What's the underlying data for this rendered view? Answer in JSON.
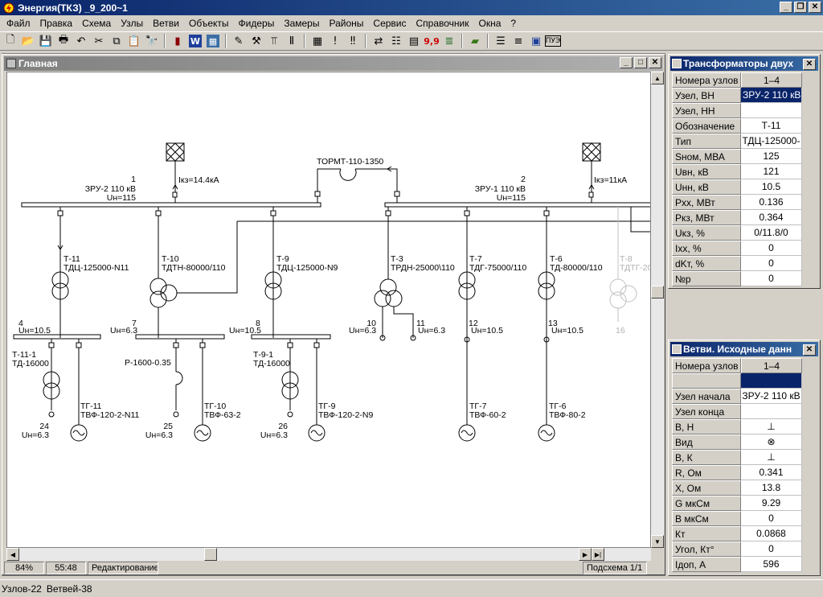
{
  "window": {
    "title": "Энергия(ТКЗ) _9_200~1",
    "minimize": "_",
    "restore": "❐",
    "close": "✕"
  },
  "menu": [
    "Файл",
    "Правка",
    "Схема",
    "Узлы",
    "Ветви",
    "Объекты",
    "Фидеры",
    "Замеры",
    "Районы",
    "Сервис",
    "Справочник",
    "Окна",
    "?"
  ],
  "toolbar": {
    "icons": [
      "new-file-icon",
      "open-folder-icon",
      "save-icon",
      "print-icon",
      "undo-icon",
      "cut-icon",
      "copy-icon",
      "paste-icon",
      "find-icon",
      "sep",
      "book-icon",
      "word-icon",
      "excel-icon",
      "sep",
      "pen-icon",
      "tool-icon",
      "insulator-icon",
      "pillar-icon",
      "sep",
      "table-icon",
      "exclaim-icon",
      "double-exclaim-icon",
      "sep",
      "swap-icon",
      "grid-icon",
      "calc-icon",
      "digits-icon",
      "bars-icon",
      "sep",
      "book-green-icon",
      "sep",
      "lines-icon",
      "doc-lines-icon",
      "window-icon",
      "pu3-icon"
    ],
    "digits_label": "9,9",
    "pu3_label": "ПУЭ"
  },
  "main": {
    "title": "Главная",
    "status": {
      "zoom": "84%",
      "coords": "55:48",
      "mode": "Редактирование",
      "subscheme": "Подсхема 1/1"
    }
  },
  "diagram": {
    "labels": {
      "node1": [
        "1",
        "ЗРУ-2 110 кВ",
        "Uн=115"
      ],
      "node2": [
        "2",
        "ЗРУ-1 110 кВ",
        "Uн=115"
      ],
      "ikz1": "Iкз=14.4кА",
      "ikz2": "Iкз=11кА",
      "reactor_top": "ТОРМТ-110-1350",
      "t11": [
        "Т-11",
        "ТДЦ-125000-N11"
      ],
      "t10": [
        "Т-10",
        "ТДТН-80000/110"
      ],
      "t9": [
        "Т-9",
        "ТДЦ-125000-N9"
      ],
      "t3": [
        "Т-3",
        "ТРДН-25000\\110"
      ],
      "t7": [
        "Т-7",
        "ТДГ-75000/110"
      ],
      "t6": [
        "Т-6",
        "ТД-80000/110"
      ],
      "t8": [
        "Т-8",
        "ТДТГ-20"
      ],
      "n4": [
        "4",
        "Uн=10.5"
      ],
      "n7": [
        "7",
        "Uн=6.3"
      ],
      "n8": [
        "8",
        "Uн=10.5"
      ],
      "n10": [
        "10",
        "Uн=6.3"
      ],
      "n11": [
        "11",
        "Uн=6.3"
      ],
      "n12": [
        "12",
        "Uн=10.5"
      ],
      "n13": [
        "13",
        "Uн=10.5"
      ],
      "n16": "16",
      "t111": [
        "Т-11-1",
        "ТД-16000"
      ],
      "t91": [
        "Т-9-1",
        "ТД-16000"
      ],
      "reactor_p": "Р-1600-0.35",
      "n24": [
        "24",
        "Uн=6.3"
      ],
      "n25": [
        "25",
        "Uн=6.3"
      ],
      "n26": [
        "26",
        "Uн=6.3"
      ],
      "g11": [
        "ТГ-11",
        "ТВФ-120-2-N11"
      ],
      "g10": [
        "ТГ-10",
        "ТВФ-63-2"
      ],
      "g9": [
        "ТГ-9",
        "ТВФ-120-2-N9"
      ],
      "g7": [
        "ТГ-7",
        "ТВФ-60-2"
      ],
      "g6": [
        "ТГ-6",
        "ТВФ-80-2"
      ]
    }
  },
  "transformers_panel": {
    "title": "Трансформаторы двух",
    "rows": [
      {
        "label": "Номера узлов",
        "value": "1–4"
      },
      {
        "label": "Узел, ВН",
        "value": "ЗРУ-2 110 кВ"
      },
      {
        "label": "Узел, НН",
        "value": ""
      },
      {
        "label": "Обозначение",
        "value": "Т-11"
      },
      {
        "label": "Тип",
        "value": "ТДЦ-125000-"
      },
      {
        "label": "Sном, МВА",
        "value": "125"
      },
      {
        "label": "Uвн, кВ",
        "value": "121"
      },
      {
        "label": "Uнн, кВ",
        "value": "10.5"
      },
      {
        "label": "Pхх, МВт",
        "value": "0.136"
      },
      {
        "label": "Pкз, МВт",
        "value": "0.364"
      },
      {
        "label": "Uкз, %",
        "value": "0/11.8/0"
      },
      {
        "label": "Iхх, %",
        "value": "0"
      },
      {
        "label": "dKт, %",
        "value": "0"
      },
      {
        "label": "№р",
        "value": "0"
      }
    ]
  },
  "branches_panel": {
    "title": "Ветви. Исходные данн",
    "rows": [
      {
        "label": "Номера узлов",
        "value": "1–4"
      },
      {
        "label": "",
        "value": ""
      },
      {
        "label": "Узел начала",
        "value": "ЗРУ-2 110 кВ"
      },
      {
        "label": "Узел конца",
        "value": ""
      },
      {
        "label": "В, Н",
        "value": "⊥"
      },
      {
        "label": "Вид",
        "value": "⊗"
      },
      {
        "label": "В, К",
        "value": "⊥"
      },
      {
        "label": "R, Ом",
        "value": "0.341"
      },
      {
        "label": "X, Ом",
        "value": "13.8"
      },
      {
        "label": "G мкСм",
        "value": "9.29"
      },
      {
        "label": "В мкСм",
        "value": "0"
      },
      {
        "label": "Кт",
        "value": "0.0868"
      },
      {
        "label": "Угол, Кт°",
        "value": "0"
      },
      {
        "label": "Iдоп, А",
        "value": "596"
      }
    ]
  },
  "bottom_status": {
    "nodes": "Узлов-22",
    "branches": "Ветвей-38"
  }
}
